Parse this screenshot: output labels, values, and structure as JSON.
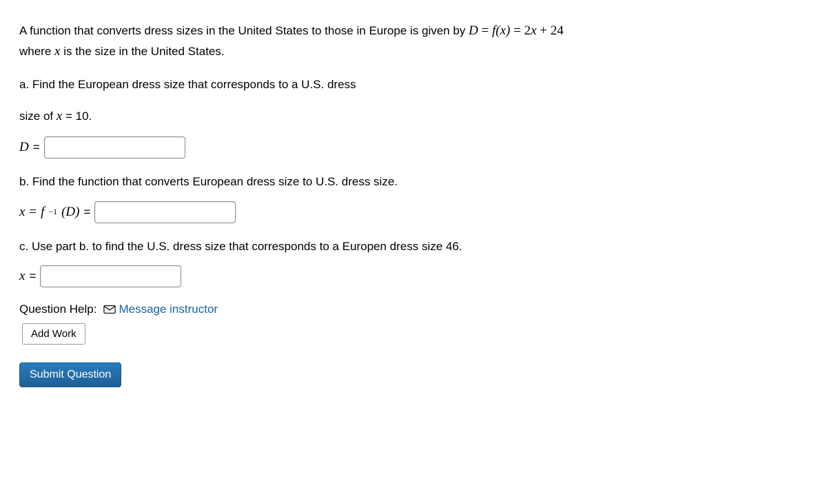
{
  "question": {
    "intro_part1": "A function that converts dress sizes in the United States to those in Europe is given by ",
    "intro_formula_D": "D",
    "intro_formula_eq1": " = ",
    "intro_formula_fx": "f(x)",
    "intro_formula_eq2": " = ",
    "intro_formula_rhs": "2x + 24",
    "intro_part2_a": "where ",
    "intro_part2_x": "x",
    "intro_part2_b": " is the size in the United States.",
    "part_a_text": "a. Find the European dress size that corresponds to a U.S. dress",
    "part_a_size_a": "size of ",
    "part_a_size_x": "x",
    "part_a_size_b": " = 10.",
    "part_a_label": "D",
    "part_a_eq": " =",
    "part_b_text": "b. Find the function that converts European dress size to U.S. dress size.",
    "part_b_label_x": "x",
    "part_b_label_eq1": " = ",
    "part_b_label_f": "f",
    "part_b_label_exp": " −1",
    "part_b_label_D": "(D)",
    "part_b_label_eq2": " =",
    "part_c_text": "c. Use part b. to find the U.S. dress size that corresponds to a Europen dress size 46.",
    "part_c_label": "x",
    "part_c_eq": " ="
  },
  "help": {
    "label": "Question Help:",
    "message_link": "Message instructor",
    "add_work": "Add Work"
  },
  "submit": {
    "label": "Submit Question"
  }
}
